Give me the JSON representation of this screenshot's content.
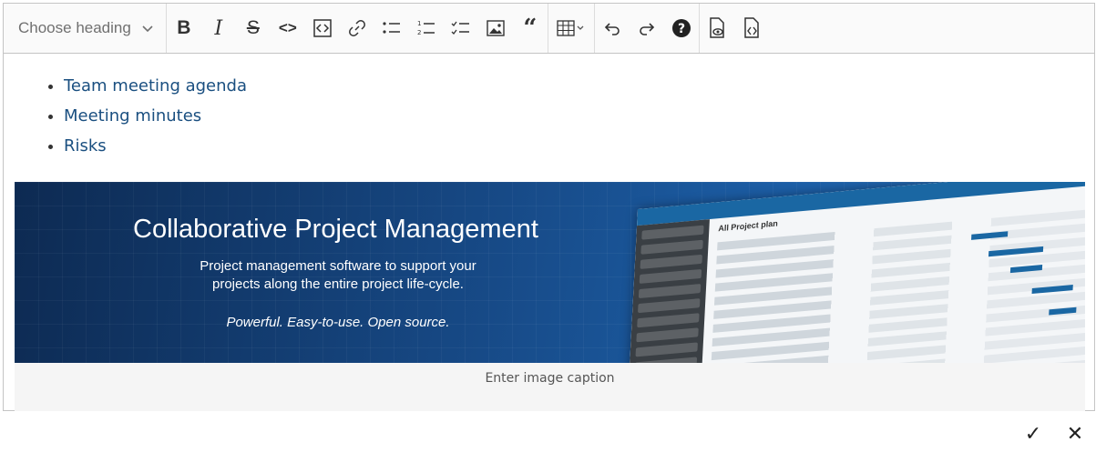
{
  "toolbar": {
    "heading_label": "Choose heading",
    "buttons": [
      "bold",
      "italic",
      "strikethrough",
      "code",
      "code-block",
      "link",
      "bulleted-list",
      "numbered-list",
      "todo-list",
      "image",
      "blockquote",
      "table",
      "undo",
      "redo",
      "help",
      "preview",
      "source"
    ]
  },
  "content": {
    "links": [
      "Team meeting agenda",
      "Meeting minutes",
      "Risks"
    ]
  },
  "banner": {
    "title": "Collaborative Project Management",
    "subtitle": "Project management software to support your\nprojects along the entire project life-cycle.",
    "tagline": "Powerful. Easy-to-use. Open source.",
    "screen_title": "All Project plan"
  },
  "caption": {
    "placeholder": "Enter image caption"
  },
  "actions": {
    "confirm_glyph": "✓",
    "cancel_glyph": "✕"
  },
  "colors": {
    "link": "#1a4f80",
    "banner_dark": "#0d2a52",
    "banner_light": "#2a74bd"
  }
}
